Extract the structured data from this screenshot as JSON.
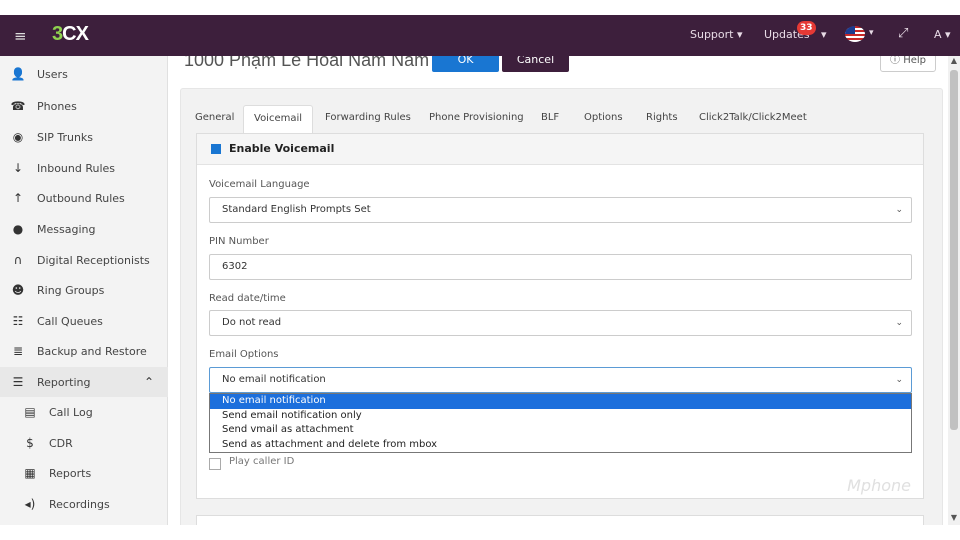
{
  "topbar": {
    "logo": "3CX",
    "support": "Support ▾",
    "updates": "Updates",
    "updates_badge": "33",
    "flag_caret": "▾",
    "user": "A ▾"
  },
  "sidebar": {
    "items": [
      {
        "label": "Users",
        "icon": "user-icon"
      },
      {
        "label": "Phones",
        "icon": "phone-icon"
      },
      {
        "label": "SIP Trunks",
        "icon": "globe-icon"
      },
      {
        "label": "Inbound Rules",
        "icon": "arrow-down-icon"
      },
      {
        "label": "Outbound Rules",
        "icon": "arrow-up-icon"
      },
      {
        "label": "Messaging",
        "icon": "chat-icon"
      },
      {
        "label": "Digital Receptionists",
        "icon": "headset-icon"
      },
      {
        "label": "Ring Groups",
        "icon": "group-icon"
      },
      {
        "label": "Call Queues",
        "icon": "users-icon"
      },
      {
        "label": "Backup and Restore",
        "icon": "database-icon"
      },
      {
        "label": "Reporting",
        "icon": "list-icon"
      },
      {
        "label": "Call Log",
        "icon": "book-icon"
      },
      {
        "label": "CDR",
        "icon": "dollar-icon"
      },
      {
        "label": "Reports",
        "icon": "document-icon"
      },
      {
        "label": "Recordings",
        "icon": "speaker-icon"
      }
    ]
  },
  "main": {
    "title": "1000 Phạm Lê Hoài Nam Nam",
    "ok_label": "OK",
    "cancel_label": "Cancel",
    "help_label": "Help",
    "tabs": [
      {
        "label": "General"
      },
      {
        "label": "Voicemail"
      },
      {
        "label": "Forwarding Rules"
      },
      {
        "label": "Phone Provisioning"
      },
      {
        "label": "BLF"
      },
      {
        "label": "Options"
      },
      {
        "label": "Rights"
      },
      {
        "label": "Click2Talk/Click2Meet"
      }
    ],
    "active_tab": "Voicemail",
    "voicemail": {
      "enable_label": "Enable Voicemail",
      "language_label": "Voicemail Language",
      "language_value": "Standard English Prompts Set",
      "pin_label": "PIN Number",
      "pin_value": "6302",
      "read_label": "Read date/time",
      "read_value": "Do not read",
      "email_label": "Email Options",
      "email_value": "No email notification",
      "email_options": [
        "No email notification",
        "Send email notification only",
        "Send vmail as attachment",
        "Send as attachment and delete from mbox"
      ],
      "play_caller_id_label": "Play caller ID",
      "watermark": "Mphone"
    }
  },
  "colors": {
    "topbar": "#3d1f3c",
    "primary_button": "#1976d2",
    "dropdown_selected": "#1c6fdc",
    "badge": "#e53935"
  }
}
